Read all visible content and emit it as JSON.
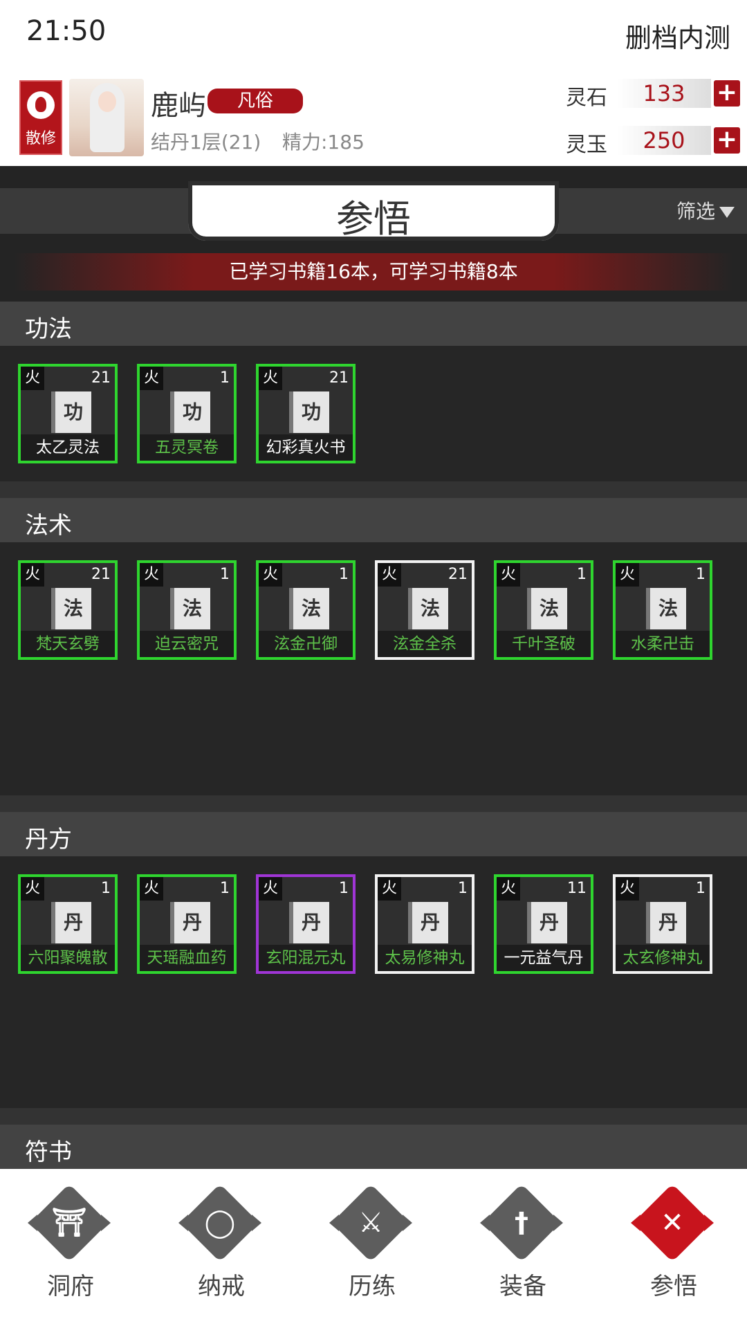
{
  "status": {
    "time": "21:50",
    "right_text": "删档内测"
  },
  "header": {
    "sect_label": "散修",
    "player_name": "鹿屿",
    "rank_tag": "凡俗",
    "realm": "结丹1层(21)",
    "energy": "精力:185",
    "currencies": [
      {
        "label": "灵石",
        "value": "133"
      },
      {
        "label": "灵玉",
        "value": "250"
      }
    ]
  },
  "page": {
    "title": "参悟",
    "filter_label": "筛选",
    "learned_summary": "已学习书籍16本，可学习书籍8本"
  },
  "sections": [
    {
      "title": "功法",
      "book_glyph": "功",
      "items": [
        {
          "element": "火",
          "level": "21",
          "name": "太乙灵法",
          "name_color": "#ffffff",
          "border": "green"
        },
        {
          "element": "火",
          "level": "1",
          "name": "五灵冥卷",
          "name_color": "#5ec24a",
          "border": "green"
        },
        {
          "element": "火",
          "level": "21",
          "name": "幻彩真火书",
          "name_color": "#ffffff",
          "border": "green"
        }
      ]
    },
    {
      "title": "法术",
      "book_glyph": "法",
      "items": [
        {
          "element": "火",
          "level": "21",
          "name": "梵天玄劈",
          "name_color": "#5ec24a",
          "border": "green"
        },
        {
          "element": "火",
          "level": "1",
          "name": "迫云密咒",
          "name_color": "#5ec24a",
          "border": "green"
        },
        {
          "element": "火",
          "level": "1",
          "name": "泫金卍御",
          "name_color": "#5ec24a",
          "border": "green"
        },
        {
          "element": "火",
          "level": "21",
          "name": "泫金全杀",
          "name_color": "#5ec24a",
          "border": "white"
        },
        {
          "element": "火",
          "level": "1",
          "name": "千叶圣破",
          "name_color": "#5ec24a",
          "border": "green"
        },
        {
          "element": "火",
          "level": "1",
          "name": "水柔卍击",
          "name_color": "#5ec24a",
          "border": "green"
        }
      ]
    },
    {
      "title": "丹方",
      "book_glyph": "丹",
      "items": [
        {
          "element": "火",
          "level": "1",
          "name": "六阳聚魄散",
          "name_color": "#5ec24a",
          "border": "green"
        },
        {
          "element": "火",
          "level": "1",
          "name": "天瑶融血药",
          "name_color": "#5ec24a",
          "border": "green"
        },
        {
          "element": "火",
          "level": "1",
          "name": "玄阳混元丸",
          "name_color": "#5ec24a",
          "border": "purple"
        },
        {
          "element": "火",
          "level": "1",
          "name": "太易修神丸",
          "name_color": "#5ec24a",
          "border": "white"
        },
        {
          "element": "火",
          "level": "11",
          "name": "一元益气丹",
          "name_color": "#ffffff",
          "border": "green"
        },
        {
          "element": "火",
          "level": "1",
          "name": "太玄修神丸",
          "name_color": "#5ec24a",
          "border": "white"
        }
      ]
    },
    {
      "title": "符书",
      "book_glyph": "",
      "items": []
    }
  ],
  "nav": [
    {
      "label": "洞府",
      "icon": "gate-icon",
      "active": false
    },
    {
      "label": "纳戒",
      "icon": "ring-icon",
      "active": false
    },
    {
      "label": "历练",
      "icon": "crossed-swords-icon",
      "active": false
    },
    {
      "label": "装备",
      "icon": "sword-icon",
      "active": false
    },
    {
      "label": "参悟",
      "icon": "close-icon",
      "active": true
    }
  ],
  "colors": {
    "accent_red": "#b3151b",
    "quality_green": "#2fd52f",
    "quality_purple": "#a035d6",
    "quality_white": "#f2f2f2"
  }
}
